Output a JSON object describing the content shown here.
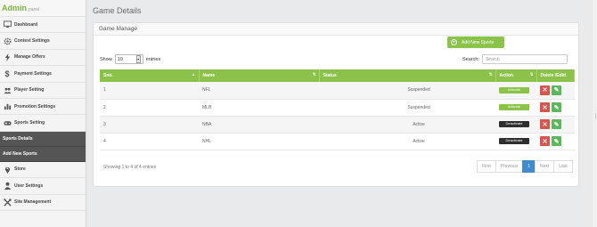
{
  "brand": {
    "title": "Admin",
    "subtitle": "panel"
  },
  "sidebar": {
    "items": [
      {
        "label": "Dashboard",
        "icon": "monitor-icon"
      },
      {
        "label": "Contest Settings",
        "icon": "gear-icon"
      },
      {
        "label": "Manage Offers",
        "icon": "bolt-icon"
      },
      {
        "label": "Payment Settings",
        "icon": "dollar-icon"
      },
      {
        "label": "Player Setting",
        "icon": "users-icon"
      },
      {
        "label": "Promotion Settings",
        "icon": "chart-icon"
      },
      {
        "label": "Sports Setting",
        "icon": "gamepad-icon"
      }
    ],
    "subitems": [
      {
        "label": "Sports Details"
      },
      {
        "label": "Add New Sports"
      }
    ],
    "items2": [
      {
        "label": "Store",
        "icon": "map-pin-icon"
      },
      {
        "label": "User Settings",
        "icon": "user-icon"
      },
      {
        "label": "Site Management",
        "icon": "tools-icon"
      }
    ]
  },
  "page": {
    "title": "Game Details"
  },
  "panel": {
    "title": "Game Manage",
    "add_button": "Add New Sports",
    "show_label": "Show",
    "show_value": "10",
    "entries_label": "entries",
    "search_label": "Search:",
    "search_placeholder": "Search"
  },
  "table": {
    "headers": [
      "Sno.",
      "Name",
      "Status",
      "Action",
      "Delete /Edit\\"
    ],
    "rows": [
      {
        "sno": "1",
        "name": "NFL",
        "status": "Suspended",
        "action": "Activate",
        "action_style": "green"
      },
      {
        "sno": "2",
        "name": "MLB",
        "status": "Suspended",
        "action": "Activate",
        "action_style": "green"
      },
      {
        "sno": "3",
        "name": "NBA",
        "status": "Active",
        "action": "Deactivate",
        "action_style": "dark"
      },
      {
        "sno": "4",
        "name": "NHL",
        "status": "Active",
        "action": "Deactivate",
        "action_style": "dark"
      }
    ]
  },
  "footer": {
    "info": "Showing 1 to 4 of 4 entries",
    "pager": [
      "First",
      "Previous",
      "1",
      "Next",
      "Last"
    ],
    "active_page": "1"
  },
  "colors": {
    "accent": "#8bc34a",
    "danger": "#d9534f",
    "primary": "#428bca"
  }
}
